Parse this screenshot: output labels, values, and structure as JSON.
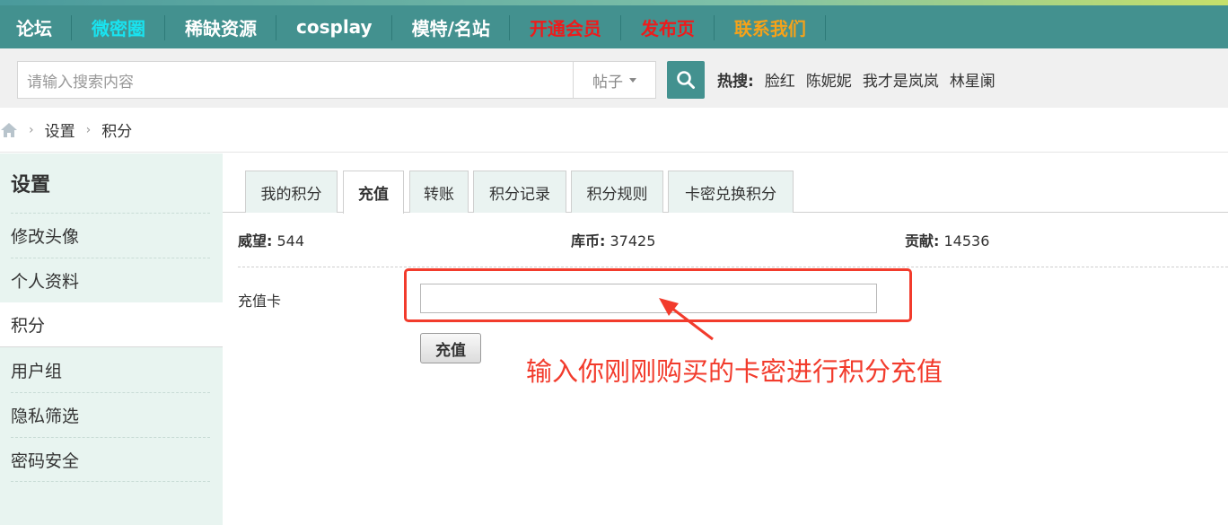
{
  "nav": {
    "items": [
      {
        "label": "论坛",
        "color": "#ffffff"
      },
      {
        "label": "微密圈",
        "color": "#19e3f0"
      },
      {
        "label": "稀缺资源",
        "color": "#ffffff"
      },
      {
        "label": "cosplay",
        "color": "#ffffff"
      },
      {
        "label": "模特/名站",
        "color": "#ffffff"
      },
      {
        "label": "开通会员",
        "color": "#ee1b1b"
      },
      {
        "label": "发布页",
        "color": "#ee1b1b"
      },
      {
        "label": "联系我们",
        "color": "#f5a21a"
      }
    ]
  },
  "search": {
    "placeholder": "请输入搜索内容",
    "type_selected": "帖子",
    "button_icon": "search-icon",
    "hot_label": "热搜:",
    "hot_items": [
      "脸红",
      "陈妮妮",
      "我才是岚岚",
      "林星阑"
    ]
  },
  "breadcrumb": {
    "home_icon": "home-icon",
    "items": [
      "设置",
      "积分"
    ]
  },
  "sidebar": {
    "title": "设置",
    "items": [
      {
        "label": "修改头像"
      },
      {
        "label": "个人资料"
      },
      {
        "label": "积分"
      },
      {
        "label": "用户组"
      },
      {
        "label": "隐私筛选"
      },
      {
        "label": "密码安全"
      }
    ]
  },
  "tabs": [
    {
      "label": "我的积分"
    },
    {
      "label": "充值"
    },
    {
      "label": "转账"
    },
    {
      "label": "积分记录"
    },
    {
      "label": "积分规则"
    },
    {
      "label": "卡密兑换积分"
    }
  ],
  "stats": [
    {
      "label": "威望:",
      "value": "544"
    },
    {
      "label": "库币:",
      "value": "37425"
    },
    {
      "label": "贡献:",
      "value": "14536"
    }
  ],
  "recharge": {
    "card_label": "充值卡",
    "card_value": "",
    "submit_label": "充值"
  },
  "annotation": {
    "text": "输入你刚刚购买的卡密进行积分充值",
    "color": "#f23b2c"
  },
  "colors": {
    "nav_bg": "#43918f",
    "sidebar_bg": "#e8f4f0"
  }
}
